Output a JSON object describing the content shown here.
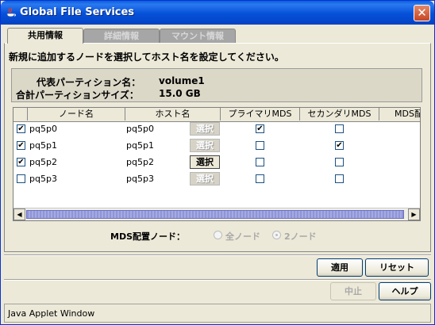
{
  "window": {
    "title": "Global File Services",
    "close_glyph": "✕"
  },
  "tabs": [
    {
      "label": "共用情報",
      "active": true
    },
    {
      "label": "詳細情報",
      "active": false
    },
    {
      "label": "マウント情報",
      "active": false
    }
  ],
  "instruction": "新規に追加するノードを選択してホスト名を設定してください。",
  "info": {
    "rep_partition_label": "代表パーティション名：",
    "rep_partition_value": "volume1",
    "total_size_label": "合計パーティションサイズ：",
    "total_size_value": "15.0 GB"
  },
  "table": {
    "columns": [
      "",
      "ノード名",
      "ホスト名",
      "プライマリMDS",
      "セカンダリMDS",
      "MDS配"
    ],
    "rows": [
      {
        "checked": true,
        "node": "pq5p0",
        "host": "pq5p0",
        "select_label": "選択",
        "select_enabled": false,
        "primary": true,
        "secondary": false
      },
      {
        "checked": true,
        "node": "pq5p1",
        "host": "pq5p1",
        "select_label": "選択",
        "select_enabled": false,
        "primary": false,
        "secondary": true
      },
      {
        "checked": true,
        "node": "pq5p2",
        "host": "pq5p2",
        "select_label": "選択",
        "select_enabled": true,
        "primary": false,
        "secondary": false
      },
      {
        "checked": false,
        "node": "pq5p3",
        "host": "pq5p3",
        "select_label": "選択",
        "select_enabled": false,
        "primary": false,
        "secondary": false
      }
    ]
  },
  "mds_placement": {
    "label": "MDS配置ノード：",
    "options": [
      {
        "label": "全ノード",
        "selected": false
      },
      {
        "label": "2ノード",
        "selected": true
      }
    ]
  },
  "buttons": {
    "apply": "適用",
    "reset": "リセット",
    "stop": "中止",
    "help": "ヘルプ"
  },
  "status": "Java Applet Window",
  "colors": {
    "titlebar": "#0550d8",
    "background": "#ece9d8",
    "scroll_thumb": "#a5aae2"
  }
}
